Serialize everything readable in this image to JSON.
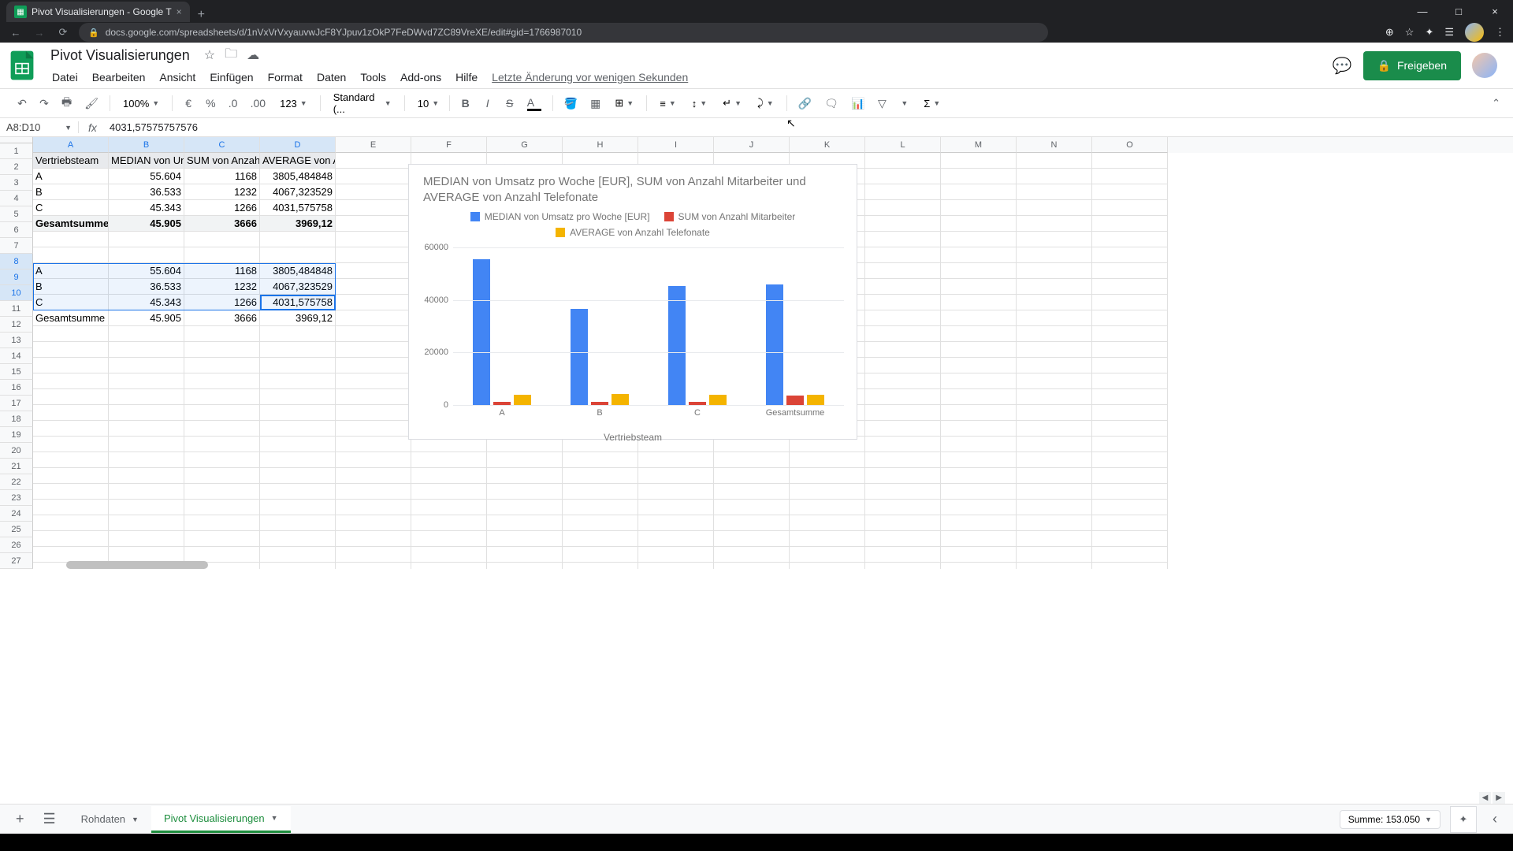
{
  "browser": {
    "tab_title": "Pivot Visualisierungen - Google T",
    "url": "docs.google.com/spreadsheets/d/1nVxVrVxyauvwJcF8YJpuv1zOkP7FeDWvd7ZC89VreXE/edit#gid=1766987010"
  },
  "doc": {
    "title": "Pivot Visualisierungen",
    "last_edit": "Letzte Änderung vor wenigen Sekunden",
    "share_label": "Freigeben"
  },
  "menus": [
    "Datei",
    "Bearbeiten",
    "Ansicht",
    "Einfügen",
    "Format",
    "Daten",
    "Tools",
    "Add-ons",
    "Hilfe"
  ],
  "toolbar": {
    "zoom": "100%",
    "currency": "€",
    "percent": "%",
    "dec_less": ".0",
    "dec_more": ".00",
    "numfmt": "123",
    "font": "Standard (...",
    "size": "10"
  },
  "formula": {
    "name_box": "A8:D10",
    "value": "4031,57575757576"
  },
  "columns": [
    "A",
    "B",
    "C",
    "D",
    "E",
    "F",
    "G",
    "H",
    "I",
    "J",
    "K",
    "L",
    "M",
    "N",
    "O"
  ],
  "rows_shown": 27,
  "pivot1": {
    "headers": [
      "Vertriebsteam",
      "MEDIAN von Un",
      "SUM von Anzah",
      "AVERAGE von A"
    ],
    "rows": [
      {
        "team": "A",
        "median": "55.604",
        "sum": "1168",
        "avg": "3805,484848"
      },
      {
        "team": "B",
        "median": "36.533",
        "sum": "1232",
        "avg": "4067,323529"
      },
      {
        "team": "C",
        "median": "45.343",
        "sum": "1266",
        "avg": "4031,575758"
      }
    ],
    "total": {
      "label": "Gesamtsumme",
      "median": "45.905",
      "sum": "3666",
      "avg": "3969,12"
    }
  },
  "pivot2": {
    "rows": [
      {
        "team": "A",
        "median": "55.604",
        "sum": "1168",
        "avg": "3805,484848"
      },
      {
        "team": "B",
        "median": "36.533",
        "sum": "1232",
        "avg": "4067,323529"
      },
      {
        "team": "C",
        "median": "45.343",
        "sum": "1266",
        "avg": "4031,575758"
      }
    ],
    "total": {
      "label": "Gesamtsumme",
      "median": "45.905",
      "sum": "3666",
      "avg": "3969,12"
    }
  },
  "chart_data": {
    "type": "bar",
    "title": "MEDIAN von Umsatz pro Woche [EUR], SUM von Anzahl Mitarbeiter und AVERAGE von Anzahl Telefonate",
    "xlabel": "Vertriebsteam",
    "ylabel": "",
    "ylim": [
      0,
      60000
    ],
    "categories": [
      "A",
      "B",
      "C",
      "Gesamtsumme"
    ],
    "series": [
      {
        "name": "MEDIAN von Umsatz pro Woche [EUR]",
        "color": "#4285f4",
        "values": [
          55604,
          36533,
          45343,
          45905
        ]
      },
      {
        "name": "SUM von Anzahl Mitarbeiter",
        "color": "#db4437",
        "values": [
          1168,
          1232,
          1266,
          3666
        ]
      },
      {
        "name": "AVERAGE von Anzahl Telefonate",
        "color": "#f4b400",
        "values": [
          3805,
          4067,
          4032,
          3969
        ]
      }
    ],
    "y_ticks": [
      0,
      20000,
      40000,
      60000
    ]
  },
  "sheettabs": {
    "tabs": [
      {
        "label": "Rohdaten",
        "active": false
      },
      {
        "label": "Pivot Visualisierungen",
        "active": true
      }
    ],
    "sum_label": "Summe: 153.050"
  }
}
